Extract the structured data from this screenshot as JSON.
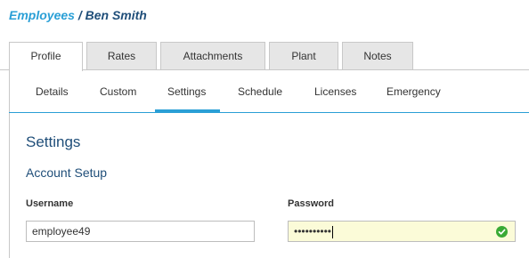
{
  "breadcrumb": {
    "parent": "Employees",
    "separator": "/",
    "current": "Ben Smith"
  },
  "top_tabs": [
    {
      "label": "Profile",
      "active": true
    },
    {
      "label": "Rates",
      "active": false
    },
    {
      "label": "Attachments",
      "active": false
    },
    {
      "label": "Plant",
      "active": false
    },
    {
      "label": "Notes",
      "active": false
    }
  ],
  "sub_tabs": [
    {
      "label": "Details",
      "active": false
    },
    {
      "label": "Custom",
      "active": false
    },
    {
      "label": "Settings",
      "active": true
    },
    {
      "label": "Schedule",
      "active": false
    },
    {
      "label": "Licenses",
      "active": false
    },
    {
      "label": "Emergency",
      "active": false
    }
  ],
  "section": {
    "title": "Settings",
    "subtitle": "Account Setup"
  },
  "form": {
    "username_label": "Username",
    "username_value": "employee49",
    "password_label": "Password",
    "password_value": "••••••••••",
    "password_valid_icon": "check-circle-icon"
  },
  "colors": {
    "accent": "#2a9fd6",
    "heading": "#1f4e79",
    "valid": "#3aaa35",
    "autofill": "#fbfbd8"
  }
}
